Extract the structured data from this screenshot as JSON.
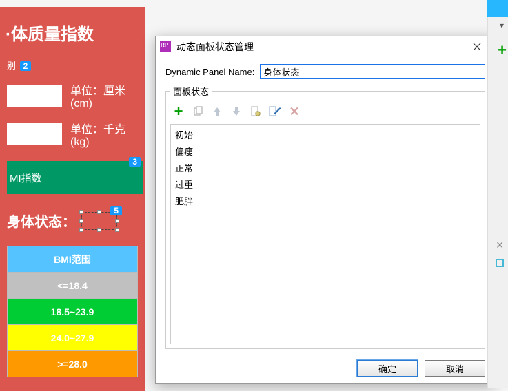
{
  "left": {
    "title": "·体质量指数",
    "label_trunc": "别",
    "annot2": "2",
    "unit_label": "单位：",
    "unit_cm": "厘米(cm)",
    "unit_kg": "千克(kg)",
    "btn_label": "MI指数",
    "btn_annot": "3",
    "status_label": "身体状态：",
    "annot5": "5",
    "table": {
      "head": "BMI范围",
      "r1": "<=18.4",
      "r2": "18.5~23.9",
      "r3": "24.0~27.9",
      "r4": ">=28.0"
    }
  },
  "dialog": {
    "title": "动态面板状态管理",
    "name_label": "Dynamic Panel Name:",
    "name_value": "身体状态",
    "fieldset_legend": "面板状态",
    "states": [
      "初始",
      "偏瘦",
      "正常",
      "过重",
      "肥胖"
    ],
    "ok": "确定",
    "cancel": "取消"
  }
}
